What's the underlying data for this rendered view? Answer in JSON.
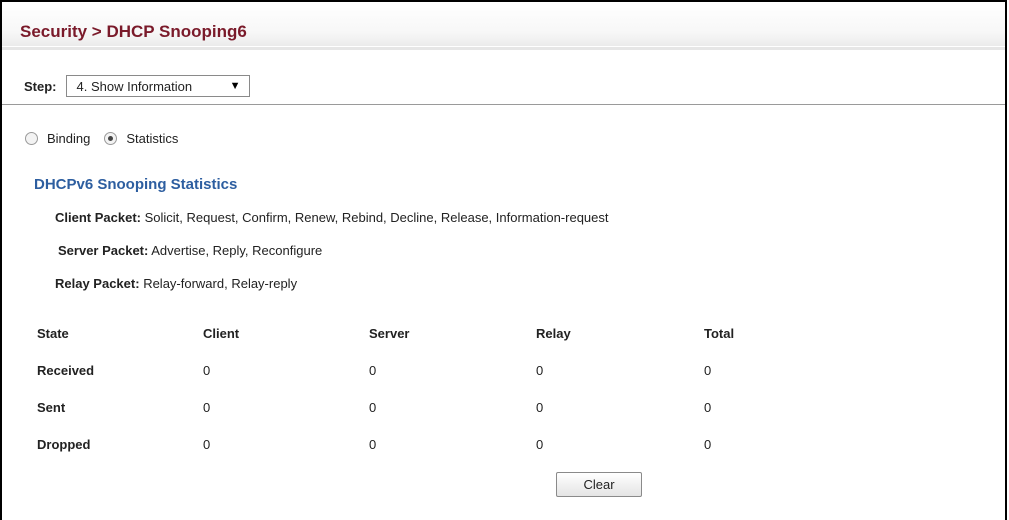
{
  "header": {
    "title": "Security > DHCP Snooping6"
  },
  "step": {
    "label": "Step:",
    "selected": "4. Show Information"
  },
  "view_options": [
    {
      "label": "Binding",
      "checked": false
    },
    {
      "label": "Statistics",
      "checked": true
    }
  ],
  "section": {
    "title": "DHCPv6 Snooping Statistics"
  },
  "packet_info": [
    {
      "label": "Client Packet:",
      "value": "Solicit, Request, Confirm, Renew, Rebind, Decline, Release, Information-request"
    },
    {
      "label": "Server Packet:",
      "value": "Advertise, Reply, Reconfigure"
    },
    {
      "label": "Relay Packet:",
      "value": "Relay-forward, Relay-reply"
    }
  ],
  "table": {
    "headers": [
      "State",
      "Client",
      "Server",
      "Relay",
      "Total"
    ],
    "rows": [
      [
        "Received",
        "0",
        "0",
        "0",
        "0"
      ],
      [
        "Sent",
        "0",
        "0",
        "0",
        "0"
      ],
      [
        "Dropped",
        "0",
        "0",
        "0",
        "0"
      ]
    ]
  },
  "actions": {
    "clear_label": "Clear"
  },
  "colors": {
    "title": "#7a1a2a",
    "section_title": "#2d5ea0"
  },
  "icons": {
    "dropdown": "triangle-down-icon"
  }
}
